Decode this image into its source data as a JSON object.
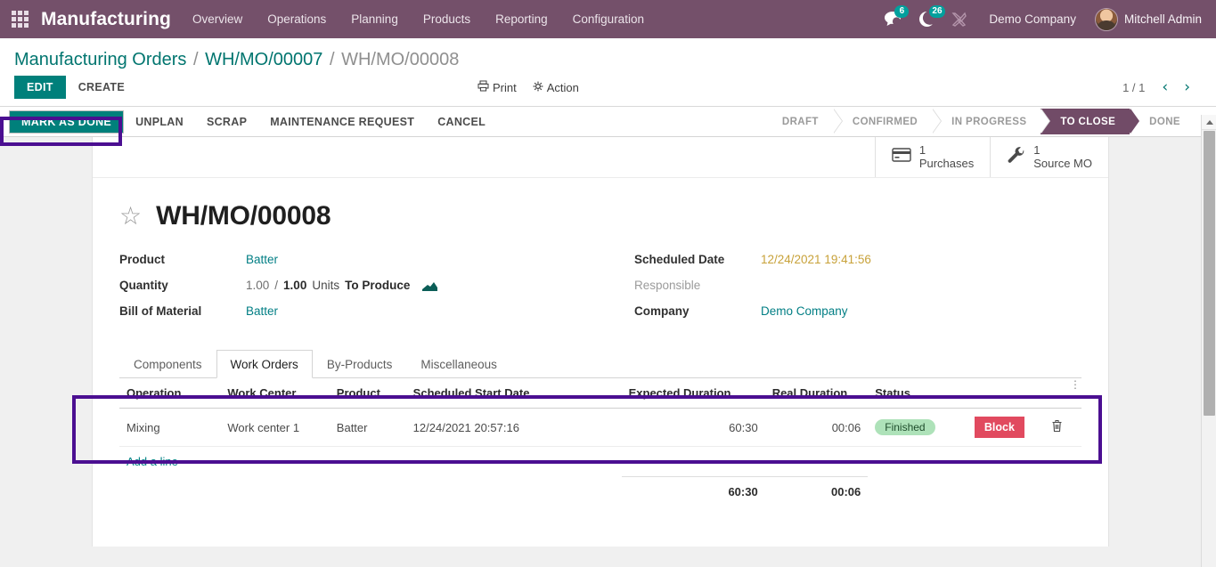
{
  "navbar": {
    "apps_icon": "apps-grid-icon",
    "brand": "Manufacturing",
    "menus": [
      "Overview",
      "Operations",
      "Planning",
      "Products",
      "Reporting",
      "Configuration"
    ],
    "messages_icon": "chat-bubble-icon",
    "messages_count": "6",
    "activities_icon": "clock-icon",
    "activities_count": "26",
    "debug_icon": "wrench-tools-icon",
    "company": "Demo Company",
    "user": "Mitchell Admin",
    "avatar_icon": "user-avatar"
  },
  "breadcrumb": {
    "root": "Manufacturing Orders",
    "sep": "/",
    "parent": "WH/MO/00007",
    "current": "WH/MO/00008"
  },
  "control_panel": {
    "edit": "EDIT",
    "create": "CREATE",
    "print": "Print",
    "print_icon": "printer-icon",
    "action": "Action",
    "action_icon": "gear-icon",
    "pager_value": "1 / 1",
    "pager_prev_icon": "chevron-left-icon",
    "pager_next_icon": "chevron-right-icon"
  },
  "statusbar": {
    "buttons": [
      {
        "label": "MARK AS DONE",
        "primary": true
      },
      {
        "label": "UNPLAN",
        "primary": false
      },
      {
        "label": "SCRAP",
        "primary": false
      },
      {
        "label": "MAINTENANCE REQUEST",
        "primary": false
      },
      {
        "label": "CANCEL",
        "primary": false
      }
    ],
    "stages": [
      {
        "label": "DRAFT",
        "active": false
      },
      {
        "label": "CONFIRMED",
        "active": false
      },
      {
        "label": "IN PROGRESS",
        "active": false
      },
      {
        "label": "TO CLOSE",
        "active": true
      },
      {
        "label": "DONE",
        "active": false
      }
    ]
  },
  "smart_buttons": [
    {
      "icon": "credit-card-icon",
      "value": "1",
      "label": "Purchases"
    },
    {
      "icon": "wrench-icon",
      "value": "1",
      "label": "Source MO"
    }
  ],
  "record": {
    "star_icon": "star-outline-icon",
    "title": "WH/MO/00008",
    "left_fields": {
      "product_label": "Product",
      "product_value": "Batter",
      "quantity_label": "Quantity",
      "quantity_done": "1.00",
      "quantity_sep": "/",
      "quantity_total": "1.00",
      "quantity_uom": "Units",
      "quantity_state": "To Produce",
      "quantity_chart_icon": "area-chart-icon",
      "bom_label": "Bill of Material",
      "bom_value": "Batter"
    },
    "right_fields": {
      "scheduled_label": "Scheduled Date",
      "scheduled_value": "12/24/2021 19:41:56",
      "responsible_label": "Responsible",
      "responsible_value": "",
      "company_label": "Company",
      "company_value": "Demo Company"
    }
  },
  "notebook": {
    "tabs": [
      {
        "label": "Components",
        "active": false
      },
      {
        "label": "Work Orders",
        "active": true
      },
      {
        "label": "By-Products",
        "active": false
      },
      {
        "label": "Miscellaneous",
        "active": false
      }
    ],
    "work_orders": {
      "columns": [
        "Operation",
        "Work Center",
        "Product",
        "Scheduled Start Date",
        "Expected Duration",
        "Real Duration",
        "Status",
        "",
        ""
      ],
      "optional_columns_icon": "vertical-dots-icon",
      "rows": [
        {
          "operation": "Mixing",
          "work_center": "Work center 1",
          "product": "Batter",
          "scheduled_start_date": "12/24/2021 20:57:16",
          "expected_duration": "60:30",
          "real_duration": "00:06",
          "status": "Finished",
          "block_label": "Block",
          "delete_icon": "trash-icon"
        }
      ],
      "add_line": "Add a line",
      "totals": {
        "expected_duration": "60:30",
        "real_duration": "00:06"
      }
    }
  },
  "colors": {
    "navbar": "#74506a",
    "primary": "#00807b",
    "link": "#017e84",
    "stage_active": "#714b67",
    "badge_finished_bg": "#aee2b9",
    "block_button": "#e14a5f",
    "annotation": "#4b0f91",
    "warning_text": "#c8a23a"
  }
}
